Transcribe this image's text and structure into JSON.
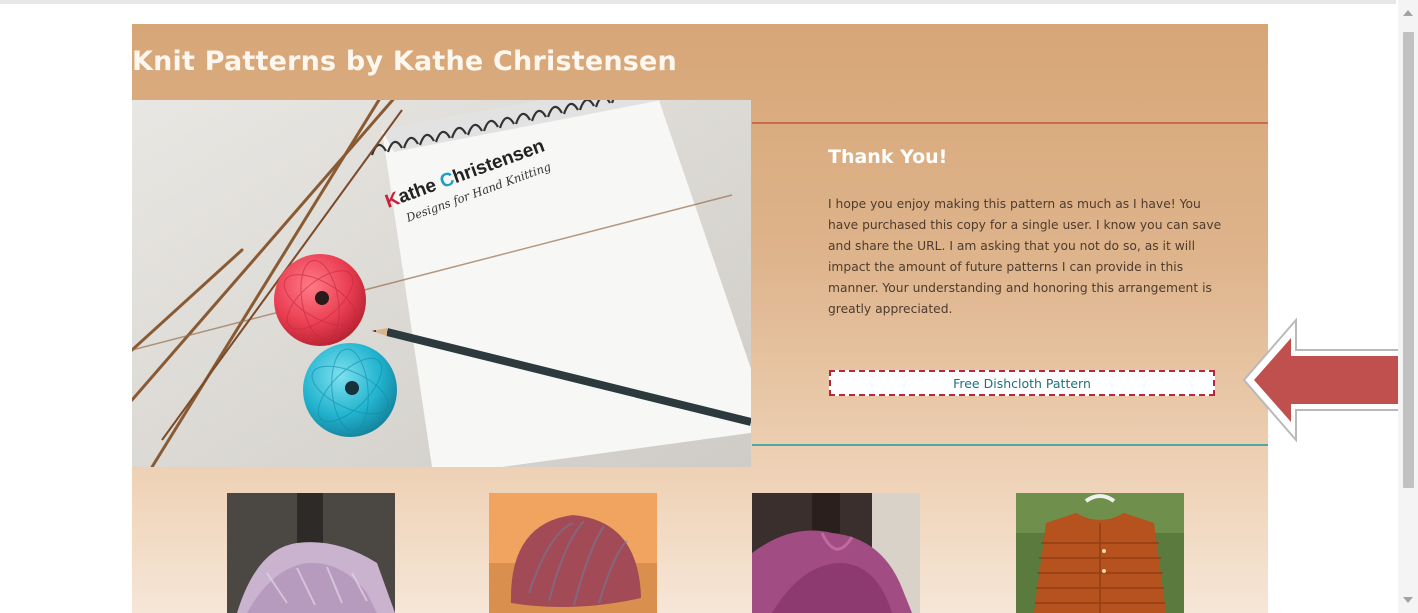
{
  "site": {
    "title": "Knit Patterns by Kathe Christensen"
  },
  "hero": {
    "notebook_brand": "Kathe Christensen",
    "notebook_tagline": "Designs for Hand Knitting"
  },
  "panel": {
    "heading": "Thank You!",
    "body": "I hope you enjoy making this pattern as much as I have! You have purchased this copy for a single user. I know you can save and share the URL. I am asking that you not do so, as it will impact the amount of future patterns I can provide in this manner. Your understanding and honoring this arrangement is greatly appreciated.",
    "button_label": "Free Dishcloth Pattern"
  },
  "colors": {
    "arrow": "#c0504d",
    "button_border": "#b3283f",
    "button_text": "#1f6f7c",
    "rule_top": "#c86a55",
    "rule_bottom": "#4ea7a3"
  },
  "icons": {
    "arrow": "left-arrow-icon"
  }
}
